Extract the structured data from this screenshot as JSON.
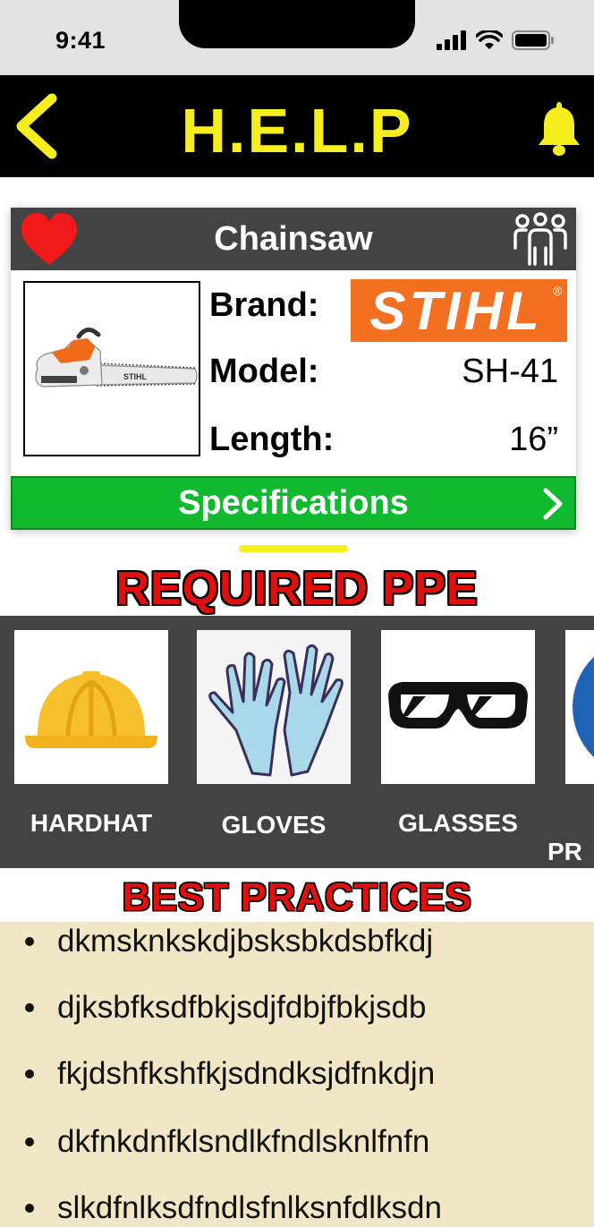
{
  "status_bar": {
    "time": "9:41"
  },
  "header": {
    "title": "H.E.L.P",
    "accent_color": "#f6ef1d"
  },
  "tool": {
    "name": "Chainsaw",
    "brand_label": "Brand:",
    "brand_logo_text": "STIHL",
    "brand_logo_mark": "®",
    "model_label": "Model:",
    "model_value": "SH-41",
    "length_label": "Length:",
    "length_value": "16”",
    "image_caption_text": "STIHL",
    "specifications_label": "Specifications"
  },
  "ppe": {
    "title": "REQUIRED PPE",
    "items": [
      {
        "label": "HARDHAT",
        "icon": "hardhat-icon"
      },
      {
        "label": "GLOVES",
        "icon": "gloves-icon"
      },
      {
        "label": "GLASSES",
        "icon": "glasses-icon"
      },
      {
        "label": "PR",
        "icon": "partial-blue-icon"
      }
    ]
  },
  "best_practices": {
    "title": "BEST PRACTICES",
    "items": [
      "dkmsknkskdjbsksbkdsbfkdj",
      "djksbfksdfbkjsdjfdbjfbkjsdb",
      "fkjdshfkshfkjsdndksjdfnkdjn",
      "dkfnkdnfklsndlkfndlsknlfnfn",
      "slkdfnlksdfndlsfnlksnfdlksdn"
    ]
  },
  "colors": {
    "header_bg": "#000000",
    "card_header_bg": "#434343",
    "spec_button": "#11b92f",
    "brand_orange": "#f37021",
    "ppe_title_red": "#e01010",
    "bp_bg": "#f1e7c6"
  }
}
